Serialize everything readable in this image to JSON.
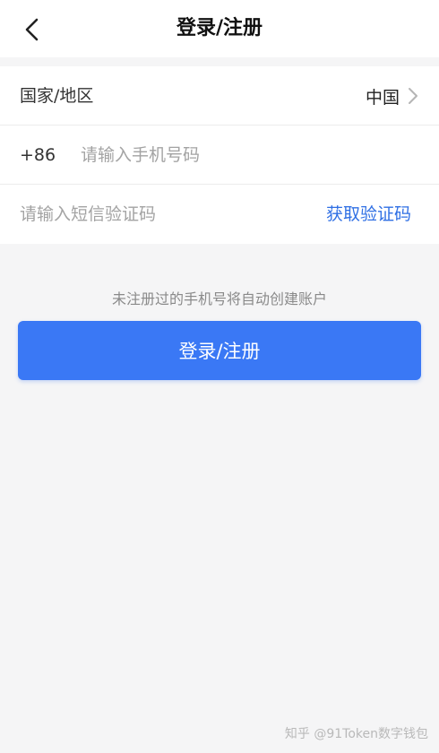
{
  "header": {
    "title": "登录/注册",
    "back_icon": "chevron-left-icon"
  },
  "form": {
    "country": {
      "label": "国家/地区",
      "value": "中国",
      "icon": "chevron-right-icon"
    },
    "phone": {
      "prefix": "+86",
      "value": "",
      "placeholder": "请输入手机号码"
    },
    "sms_code": {
      "value": "",
      "placeholder": "请输入短信验证码",
      "action_label": "获取验证码"
    }
  },
  "hint": "未注册过的手机号将自动创建账户",
  "submit_label": "登录/注册",
  "watermark": "知乎 @91Token数字钱包",
  "colors": {
    "accent": "#3a78f5",
    "link": "#2f6fe4",
    "background": "#f5f5f6"
  }
}
